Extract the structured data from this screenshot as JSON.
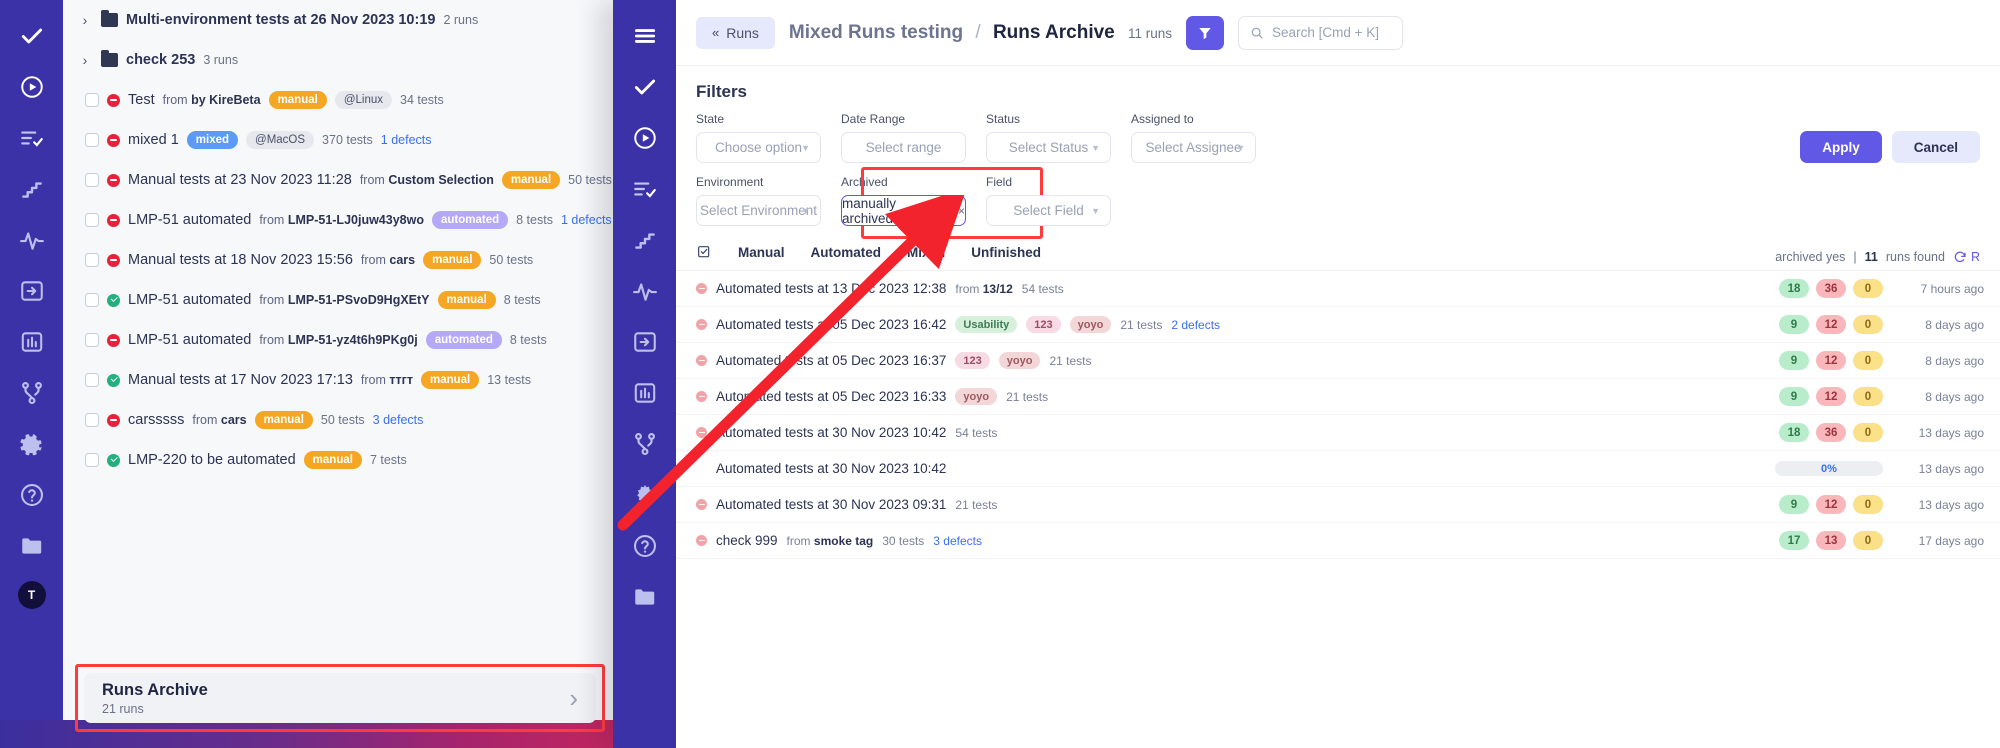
{
  "left_panel": {
    "rail_icons": [
      "check-icon",
      "play-circle-icon",
      "list-check-icon",
      "steps-icon",
      "activity-icon",
      "login-icon",
      "chart-bar-icon",
      "branch-icon",
      "gear-icon",
      "help-icon",
      "folder-icon"
    ],
    "avatar": "T",
    "rows": [
      {
        "type": "folder",
        "name": "Multi-environment tests at 26 Nov 2023 10:19",
        "count": "2 runs"
      },
      {
        "type": "folder",
        "name": "check 253",
        "count": "3 runs"
      },
      {
        "type": "run",
        "status": "fail",
        "name": "Test",
        "from_label": "from",
        "from": "by KireBeta",
        "tag": "manual",
        "tag_kind": "manual",
        "env": "@Linux",
        "tests": "34 tests",
        "defects": ""
      },
      {
        "type": "run",
        "status": "fail",
        "name": "mixed 1",
        "from_label": "",
        "from": "",
        "tag": "mixed",
        "tag_kind": "mixed",
        "env": "@MacOS",
        "tests": "370 tests",
        "defects": "1 defects"
      },
      {
        "type": "run",
        "status": "fail",
        "name": "Manual tests at 23 Nov 2023 11:28",
        "from_label": "from",
        "from": "Custom Selection",
        "tag": "manual",
        "tag_kind": "manual",
        "env": "",
        "tests": "50 tests",
        "defects": ""
      },
      {
        "type": "run",
        "status": "fail",
        "name": "LMP-51 automated",
        "from_label": "from",
        "from": "LMP-51-LJ0juw43y8wo",
        "tag": "automated",
        "tag_kind": "automated",
        "env": "",
        "tests": "8 tests",
        "defects": "1 defects"
      },
      {
        "type": "run",
        "status": "fail",
        "name": "Manual tests at 18 Nov 2023 15:56",
        "from_label": "from",
        "from": "cars",
        "tag": "manual",
        "tag_kind": "manual",
        "env": "",
        "tests": "50 tests",
        "defects": ""
      },
      {
        "type": "run",
        "status": "pass",
        "name": "LMP-51 automated",
        "from_label": "from",
        "from": "LMP-51-PSvoD9HgXEtY",
        "tag": "manual",
        "tag_kind": "manual",
        "env": "",
        "tests": "8 tests",
        "defects": ""
      },
      {
        "type": "run",
        "status": "fail",
        "name": "LMP-51 automated",
        "from_label": "from",
        "from": "LMP-51-yz4t6h9PKg0j",
        "tag": "automated",
        "tag_kind": "automated",
        "env": "",
        "tests": "8 tests",
        "defects": ""
      },
      {
        "type": "run",
        "status": "pass",
        "name": "Manual tests at 17 Nov 2023 17:13",
        "from_label": "from",
        "from": "ттгт",
        "tag": "manual",
        "tag_kind": "manual",
        "env": "",
        "tests": "13 tests",
        "defects": ""
      },
      {
        "type": "run",
        "status": "fail",
        "name": "carsssss",
        "from_label": "from",
        "from": "cars",
        "tag": "manual",
        "tag_kind": "manual",
        "env": "",
        "tests": "50 tests",
        "defects": "3 defects"
      },
      {
        "type": "run",
        "status": "pass",
        "name": "LMP-220 to be automated",
        "from_label": "",
        "from": "",
        "tag": "manual",
        "tag_kind": "manual",
        "env": "",
        "tests": "7 tests",
        "defects": ""
      }
    ],
    "archive_card": {
      "title": "Runs Archive",
      "subtitle": "21 runs",
      "chevron": "chevron-right-icon"
    }
  },
  "front_panel": {
    "rail_icons": [
      "hamburger-icon",
      "check-icon",
      "play-circle-icon",
      "list-check-icon",
      "steps-icon",
      "activity-icon",
      "login-icon",
      "chart-bar-icon",
      "branch-icon",
      "gear-icon",
      "help-icon",
      "folder-icon"
    ],
    "header": {
      "back_label": "Runs",
      "back_chevrons": "«",
      "crumb_parent": "Mixed Runs testing",
      "crumb_sep": "/",
      "crumb_current": "Runs Archive",
      "crumb_count": "11 runs",
      "filter_icon": "funnel-icon",
      "search_icon": "search-icon",
      "search_placeholder": "Search [Cmd + K]"
    },
    "filters": {
      "heading": "Filters",
      "row1": [
        {
          "label": "State",
          "value": "Choose option",
          "has_caret": true,
          "active": false
        },
        {
          "label": "Date Range",
          "value": "Select range",
          "has_caret": false,
          "active": false
        },
        {
          "label": "Status",
          "value": "Select Status",
          "has_caret": true,
          "active": false
        },
        {
          "label": "Assigned to",
          "value": "Select Assignee",
          "has_caret": true,
          "active": false
        }
      ],
      "row2": [
        {
          "label": "Environment",
          "value": "Select Environment",
          "has_caret": true,
          "active": false
        },
        {
          "label": "Archived",
          "value": "manually archived",
          "has_caret": true,
          "active": true,
          "clear": "×"
        },
        {
          "label": "Field",
          "value": "Select Field",
          "has_caret": true,
          "active": false
        }
      ],
      "apply_label": "Apply",
      "cancel_label": "Cancel"
    },
    "tabs": {
      "select_icon": "checklist-icon",
      "items": [
        "Manual",
        "Automated",
        "Mixed",
        "Unfinished"
      ],
      "status_archived": "archived yes",
      "status_divider": "|",
      "status_count": "11",
      "status_found": "runs found",
      "refresh_icon": "refresh-icon",
      "refresh_label": "R"
    },
    "table": {
      "rows": [
        {
          "status": "fail",
          "name": "Automated tests at 13 Dec 2023 12:38",
          "from_label": "from",
          "from": "13/12",
          "tags": [],
          "tests": "54 tests",
          "defects": "",
          "pills": [
            {
              "v": "18",
              "c": "g"
            },
            {
              "v": "36",
              "c": "r"
            },
            {
              "v": "0",
              "c": "y"
            }
          ],
          "progress": "",
          "time": "7 hours ago"
        },
        {
          "status": "fail",
          "name": "Automated tests at 05 Dec 2023 16:42",
          "from_label": "",
          "from": "",
          "tags": [
            {
              "t": "Usability",
              "c": "green"
            },
            {
              "t": "123",
              "c": "pink"
            },
            {
              "t": "yoyo",
              "c": "rose"
            }
          ],
          "tests": "21 tests",
          "defects": "2 defects",
          "pills": [
            {
              "v": "9",
              "c": "g"
            },
            {
              "v": "12",
              "c": "r"
            },
            {
              "v": "0",
              "c": "y"
            }
          ],
          "progress": "",
          "time": "8 days ago"
        },
        {
          "status": "fail",
          "name": "Automated tests at 05 Dec 2023 16:37",
          "from_label": "",
          "from": "",
          "tags": [
            {
              "t": "123",
              "c": "pink"
            },
            {
              "t": "yoyo",
              "c": "rose"
            }
          ],
          "tests": "21 tests",
          "defects": "",
          "pills": [
            {
              "v": "9",
              "c": "g"
            },
            {
              "v": "12",
              "c": "r"
            },
            {
              "v": "0",
              "c": "y"
            }
          ],
          "progress": "",
          "time": "8 days ago"
        },
        {
          "status": "fail",
          "name": "Automated tests at 05 Dec 2023 16:33",
          "from_label": "",
          "from": "",
          "tags": [
            {
              "t": "yoyo",
              "c": "rose"
            }
          ],
          "tests": "21 tests",
          "defects": "",
          "pills": [
            {
              "v": "9",
              "c": "g"
            },
            {
              "v": "12",
              "c": "r"
            },
            {
              "v": "0",
              "c": "y"
            }
          ],
          "progress": "",
          "time": "8 days ago"
        },
        {
          "status": "fail",
          "name": "Automated tests at 30 Nov 2023 10:42",
          "from_label": "",
          "from": "",
          "tags": [],
          "tests": "54 tests",
          "defects": "",
          "pills": [
            {
              "v": "18",
              "c": "g"
            },
            {
              "v": "36",
              "c": "r"
            },
            {
              "v": "0",
              "c": "y"
            }
          ],
          "progress": "",
          "time": "13 days ago"
        },
        {
          "status": "mute",
          "name": "Automated tests at 30 Nov 2023 10:42",
          "from_label": "",
          "from": "",
          "tags": [],
          "tests": "",
          "defects": "",
          "pills": [],
          "progress": "0%",
          "time": "13 days ago"
        },
        {
          "status": "fail",
          "name": "Automated tests at 30 Nov 2023 09:31",
          "from_label": "",
          "from": "",
          "tags": [],
          "tests": "21 tests",
          "defects": "",
          "pills": [
            {
              "v": "9",
              "c": "g"
            },
            {
              "v": "12",
              "c": "r"
            },
            {
              "v": "0",
              "c": "y"
            }
          ],
          "progress": "",
          "time": "13 days ago"
        },
        {
          "status": "fail",
          "name": "check 999",
          "from_label": "from",
          "from": "smoke tag",
          "tags": [],
          "tests": "30 tests",
          "defects": "3 defects",
          "pills": [
            {
              "v": "17",
              "c": "g"
            },
            {
              "v": "13",
              "c": "r"
            },
            {
              "v": "0",
              "c": "y"
            }
          ],
          "progress": "",
          "time": "17 days ago"
        }
      ]
    }
  }
}
